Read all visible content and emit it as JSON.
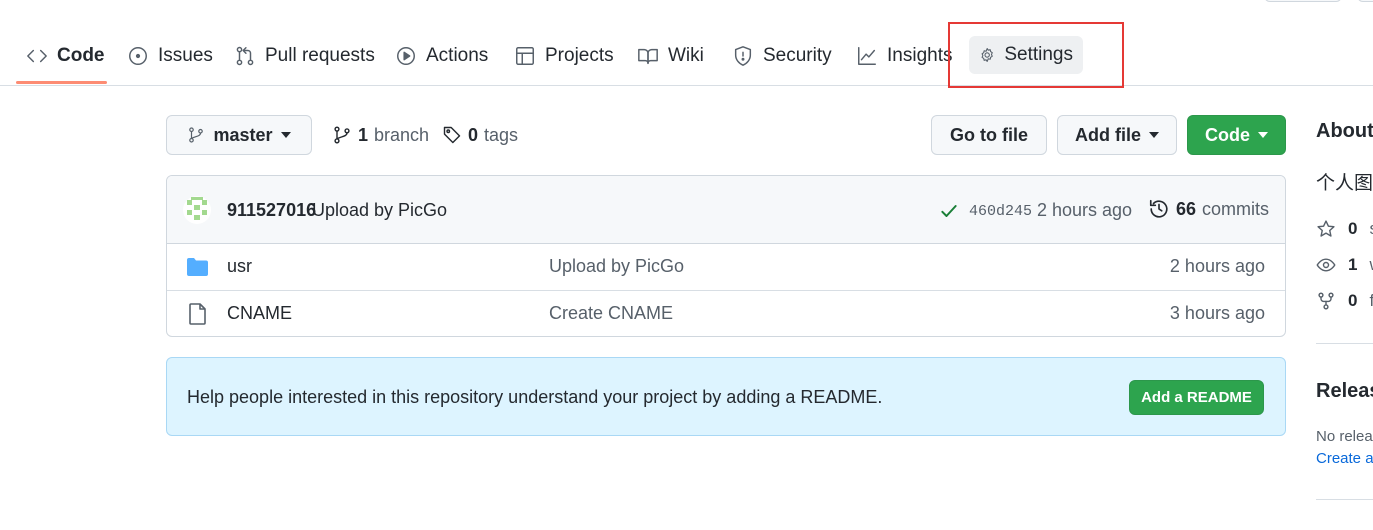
{
  "repo_nav": {
    "tabs": [
      {
        "label": "Code",
        "icon": "code-icon",
        "selected": true
      },
      {
        "label": "Issues",
        "icon": "issue-icon"
      },
      {
        "label": "Pull requests",
        "icon": "pull-request-icon"
      },
      {
        "label": "Actions",
        "icon": "play-icon"
      },
      {
        "label": "Projects",
        "icon": "table-icon"
      },
      {
        "label": "Wiki",
        "icon": "book-icon"
      },
      {
        "label": "Security",
        "icon": "shield-icon"
      },
      {
        "label": "Insights",
        "icon": "graph-icon"
      },
      {
        "label": "Settings",
        "icon": "gear-icon",
        "highlighted": true
      }
    ]
  },
  "toolbar": {
    "branch_name": "master",
    "branch_count": "1",
    "branch_label": "branch",
    "tag_count": "0",
    "tag_label": "tags",
    "go_to_file": "Go to file",
    "add_file": "Add file",
    "code_button": "Code"
  },
  "latest_commit": {
    "author": "911527016",
    "message": "Upload by PicGo",
    "sha": "460d245",
    "time": "2 hours ago",
    "commit_count": "66",
    "commit_label": "commits",
    "status": "success"
  },
  "files": [
    {
      "type": "directory",
      "icon": "folder-icon",
      "name": "usr",
      "message": "Upload by PicGo",
      "time": "2 hours ago"
    },
    {
      "type": "file",
      "icon": "file-icon",
      "name": "CNAME",
      "message": "Create CNAME",
      "time": "3 hours ago"
    }
  ],
  "readme_banner": {
    "message": "Help people interested in this repository understand your project by adding a README.",
    "button": "Add a README"
  },
  "sidebar": {
    "about_title": "About",
    "description": "个人图",
    "stars": {
      "count": "0",
      "label": "s"
    },
    "watchers": {
      "count": "1",
      "label": "w"
    },
    "forks": {
      "count": "0",
      "label": "f"
    },
    "releases_title": "Releas",
    "no_releases": "No releas",
    "create_link": "Create a"
  },
  "colors": {
    "accent_underline": "#fd8c73",
    "primary_green": "#2da44e",
    "link_blue": "#0969da",
    "folder_blue": "#54aeff",
    "highlight_red": "#e53935",
    "banner_bg": "#ddf4ff"
  }
}
